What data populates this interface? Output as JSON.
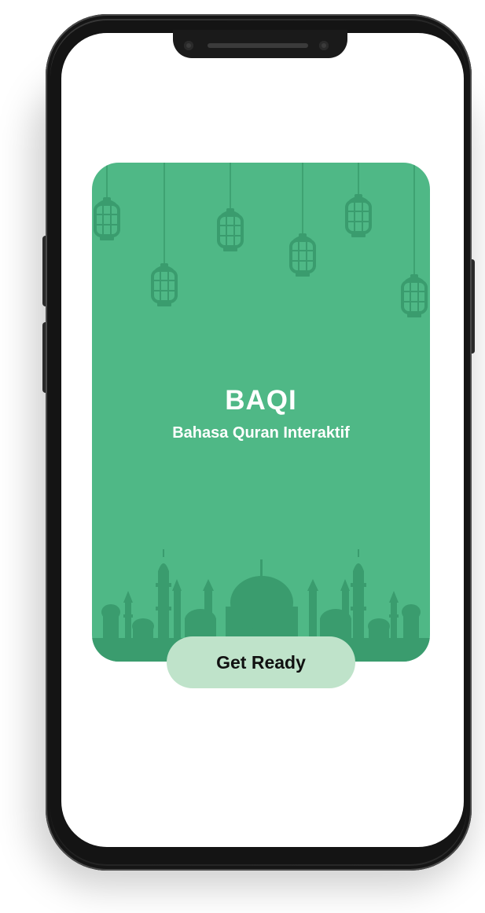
{
  "splash": {
    "title": "BAQI",
    "subtitle": "Bahasa Quran Interaktif",
    "button_label": "Get Ready"
  },
  "decorations": {
    "top": "lantern-icon",
    "bottom": "mosque-skyline-icon"
  },
  "colors": {
    "card_background": "#4fb886",
    "ornament": "#3a9c6e",
    "button_background": "#bfe3ca",
    "button_text": "#111111",
    "title_text": "#ffffff",
    "phone_frame": "#1d1d1d",
    "screen_background": "#ffffff"
  }
}
